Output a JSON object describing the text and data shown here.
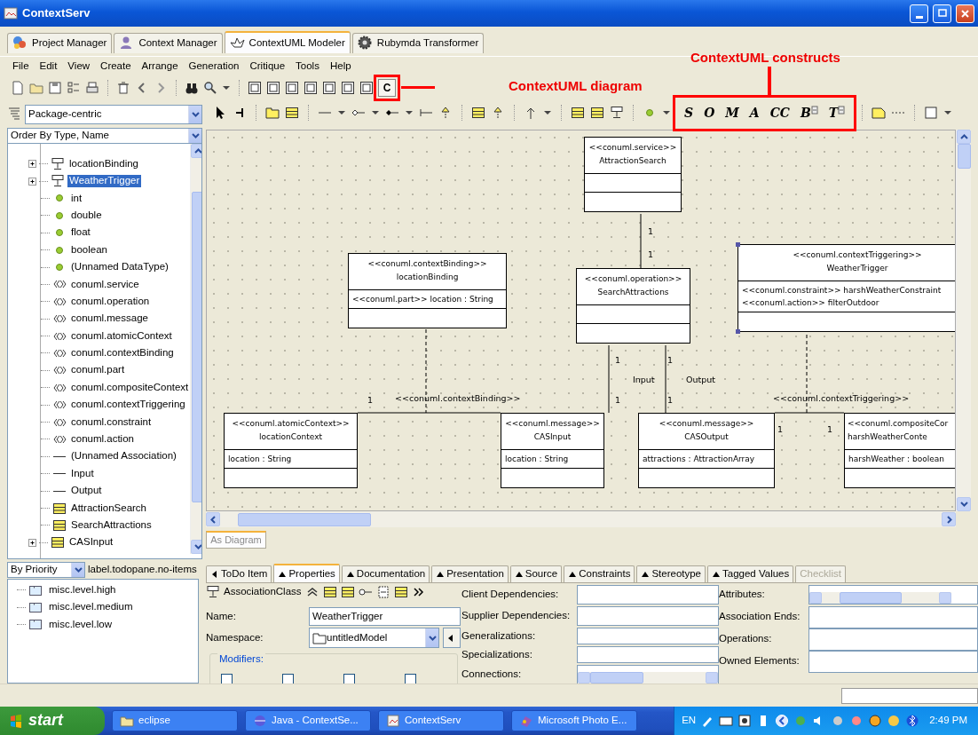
{
  "window": {
    "title": "ContextServ"
  },
  "app_tabs": [
    {
      "label": "Project Manager",
      "kind": "project",
      "selected": false
    },
    {
      "label": "Context Manager",
      "kind": "person",
      "selected": false
    },
    {
      "label": "ContextUML Modeler",
      "kind": "boat",
      "selected": true
    },
    {
      "label": "Rubymda Transformer",
      "kind": "gear",
      "selected": false
    }
  ],
  "menu": [
    "File",
    "Edit",
    "View",
    "Create",
    "Arrange",
    "Generation",
    "Critique",
    "Tools",
    "Help"
  ],
  "toolbar": {
    "diagram_button": "C"
  },
  "callouts": [
    {
      "text": "ContextUML diagram"
    },
    {
      "text": "ContextUML constructs"
    }
  ],
  "navigator": {
    "perspective": "Package-centric",
    "order": "Order By Type, Name",
    "tree": [
      {
        "label": "locationBinding",
        "kind": "assocclass",
        "expandable": true,
        "selected": false
      },
      {
        "label": "WeatherTrigger",
        "kind": "assocclass",
        "expandable": true,
        "selected": true
      },
      {
        "label": "int",
        "kind": "datatype",
        "expandable": false,
        "selected": false
      },
      {
        "label": "double",
        "kind": "datatype",
        "expandable": false,
        "selected": false
      },
      {
        "label": "float",
        "kind": "datatype",
        "expandable": false,
        "selected": false
      },
      {
        "label": "boolean",
        "kind": "datatype",
        "expandable": false,
        "selected": false
      },
      {
        "label": "(Unnamed DataType)",
        "kind": "datatype",
        "expandable": false,
        "selected": false
      },
      {
        "label": "conuml.service",
        "kind": "stereotype",
        "expandable": false,
        "selected": false
      },
      {
        "label": "conuml.operation",
        "kind": "stereotype",
        "expandable": false,
        "selected": false
      },
      {
        "label": "conuml.message",
        "kind": "stereotype",
        "expandable": false,
        "selected": false
      },
      {
        "label": "conuml.atomicContext",
        "kind": "stereotype",
        "expandable": false,
        "selected": false
      },
      {
        "label": "conuml.contextBinding",
        "kind": "stereotype",
        "expandable": false,
        "selected": false
      },
      {
        "label": "conuml.part",
        "kind": "stereotype",
        "expandable": false,
        "selected": false
      },
      {
        "label": "conuml.compositeContext",
        "kind": "stereotype",
        "expandable": false,
        "selected": false
      },
      {
        "label": "conuml.contextTriggering",
        "kind": "stereotype",
        "expandable": false,
        "selected": false
      },
      {
        "label": "conuml.constraint",
        "kind": "stereotype",
        "expandable": false,
        "selected": false
      },
      {
        "label": "conuml.action",
        "kind": "stereotype",
        "expandable": false,
        "selected": false
      },
      {
        "label": "(Unnamed Association)",
        "kind": "association",
        "expandable": false,
        "selected": false
      },
      {
        "label": "Input",
        "kind": "association",
        "expandable": false,
        "selected": false
      },
      {
        "label": "Output",
        "kind": "association",
        "expandable": false,
        "selected": false
      },
      {
        "label": "AttractionSearch",
        "kind": "class",
        "expandable": false,
        "selected": false
      },
      {
        "label": "SearchAttractions",
        "kind": "class",
        "expandable": false,
        "selected": false
      },
      {
        "label": "CASInput",
        "kind": "class",
        "expandable": true,
        "selected": false
      }
    ]
  },
  "diagram_tools": {
    "constructs": [
      {
        "label": "S",
        "kind": "letter"
      },
      {
        "label": "O",
        "kind": "letter"
      },
      {
        "label": "M",
        "kind": "letter"
      },
      {
        "label": "A",
        "kind": "letter"
      },
      {
        "label": "CC",
        "kind": "letter"
      },
      {
        "label": "B",
        "kind": "tagged"
      },
      {
        "label": "T",
        "kind": "tagged"
      }
    ]
  },
  "diagram": {
    "classes": [
      {
        "stereotype": "<<conuml.service>>",
        "name": "AttractionSearch",
        "selected": false
      },
      {
        "stereotype": "<<conuml.contextBinding>>",
        "name": "locationBinding",
        "attributes": [
          "<<conuml.part>> location : String"
        ],
        "selected": false
      },
      {
        "stereotype": "<<conuml.operation>>",
        "name": "SearchAttractions",
        "selected": false
      },
      {
        "stereotype": "<<conuml.contextTriggering>>",
        "name": "WeatherTrigger",
        "attributes": [
          "<<conuml.constraint>> harshWeatherConstraint",
          "<<conuml.action>> filterOutdoor"
        ],
        "selected": true
      },
      {
        "stereotype": "<<conuml.atomicContext>>",
        "name": "locationContext",
        "attributes": [
          "location : String"
        ],
        "selected": false
      },
      {
        "stereotype": "<<conuml.message>>",
        "name": "CASInput",
        "attributes": [
          "location : String"
        ],
        "selected": false
      },
      {
        "stereotype": "<<conuml.message>>",
        "name": "CASOutput",
        "attributes": [
          "attractions : AttractionArray"
        ],
        "selected": false
      },
      {
        "stereotype": "<<conuml.compositeCor",
        "name": "harshWeatherConte",
        "attributes": [
          "harshWeather : boolean"
        ],
        "selected": false
      }
    ],
    "edge_labels": [
      "1",
      "1",
      "1",
      "1",
      "Input",
      "Output",
      "1",
      "<<conuml.contextBinding>>",
      "1",
      "1",
      "<<conuml.contextTriggering>>",
      "1",
      "1"
    ]
  },
  "diagram_tab": {
    "label": "As Diagram"
  },
  "todo": {
    "filter": "By Priority",
    "status": "label.todopane.no-items",
    "items": [
      {
        "label": "misc.level.high"
      },
      {
        "label": "misc.level.medium"
      },
      {
        "label": "misc.level.low"
      }
    ]
  },
  "details": {
    "tabs": [
      {
        "label": "ToDo Item",
        "kind": "left",
        "selected": false,
        "disabled": false
      },
      {
        "label": "Properties",
        "kind": "up",
        "selected": true,
        "disabled": false
      },
      {
        "label": "Documentation",
        "kind": "up",
        "selected": false,
        "disabled": false
      },
      {
        "label": "Presentation",
        "kind": "up",
        "selected": false,
        "disabled": false
      },
      {
        "label": "Source",
        "kind": "up",
        "selected": false,
        "disabled": false
      },
      {
        "label": "Constraints",
        "kind": "up",
        "selected": false,
        "disabled": false
      },
      {
        "label": "Stereotype",
        "kind": "up",
        "selected": false,
        "disabled": false
      },
      {
        "label": "Tagged Values",
        "kind": "up",
        "selected": false,
        "disabled": false
      },
      {
        "label": "Checklist",
        "kind": "plain",
        "selected": false,
        "disabled": true
      }
    ],
    "properties": {
      "element_type": "AssociationClass",
      "name_label": "Name:",
      "name": "WeatherTrigger",
      "namespace_label": "Namespace:",
      "namespace": "untitledModel",
      "modifiers_label": "Modifiers:",
      "modifiers": [
        {
          "checked": false
        },
        {
          "checked": false
        },
        {
          "checked": false
        },
        {
          "checked": false
        }
      ],
      "middle_fields": [
        "Client Dependencies:",
        "Supplier Dependencies:",
        "Generalizations:",
        "Specializations:",
        "Connections:"
      ],
      "right_fields": [
        "Attributes:",
        "Association Ends:",
        "Operations:",
        "Owned Elements:"
      ]
    }
  },
  "taskbar": {
    "start": "start",
    "tasks": [
      {
        "label": "eclipse",
        "kind": "folder"
      },
      {
        "label": "Java - ContextSe...",
        "kind": "java"
      },
      {
        "label": "ContextServ",
        "kind": "app"
      },
      {
        "label": "Microsoft Photo E...",
        "kind": "photo"
      }
    ],
    "language": "EN",
    "clock": "2:49 PM"
  }
}
